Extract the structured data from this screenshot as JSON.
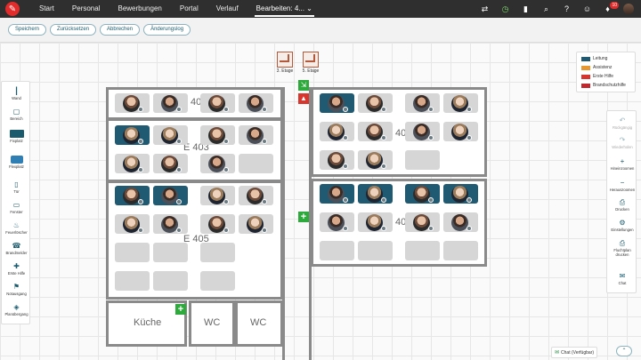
{
  "nav": {
    "items": [
      {
        "label": "Start"
      },
      {
        "label": "Personal"
      },
      {
        "label": "Bewerbungen"
      },
      {
        "label": "Portal"
      },
      {
        "label": "Verlauf"
      },
      {
        "label": "Bearbeiten: 4..."
      }
    ],
    "badge": "10"
  },
  "toolbar": {
    "save": "Speichern",
    "reset": "Zurücksetzen",
    "cancel": "Abbrechen",
    "changelog": "Änderungslog"
  },
  "palette": [
    {
      "label": "Wand",
      "icon": "wall-icon"
    },
    {
      "label": "Bereich",
      "icon": "area-icon"
    },
    {
      "label": "Fixplatz",
      "icon": "fixed-desk-icon"
    },
    {
      "label": "Flexplatz",
      "icon": "flex-desk-icon"
    },
    {
      "label": "Tür",
      "icon": "door-icon"
    },
    {
      "label": "Fenster",
      "icon": "window-icon"
    },
    {
      "label": "Feuerlöscher",
      "icon": "extinguisher-icon"
    },
    {
      "label": "Brandmelder",
      "icon": "fire-alarm-icon"
    },
    {
      "label": "Erste Hilfe",
      "icon": "first-aid-icon"
    },
    {
      "label": "Notausgang",
      "icon": "emergency-exit-icon"
    },
    {
      "label": "Planübergang",
      "icon": "plan-transition-icon"
    }
  ],
  "floors": [
    {
      "label": "3. Etage"
    },
    {
      "label": "5. Etage"
    }
  ],
  "legend": [
    {
      "label": "Leitung",
      "color": "#1f5a72"
    },
    {
      "label": "Assistenz",
      "color": "#e8962e"
    },
    {
      "label": "Erste Hilfe",
      "color": "#2eaa3c"
    },
    {
      "label": "Brandschutzhilfe",
      "color": "#d9352c"
    }
  ],
  "right_panel": [
    {
      "label": "Rückgängig",
      "icon": "undo-icon",
      "enabled": false
    },
    {
      "label": "Wiederholen",
      "icon": "redo-icon",
      "enabled": false
    },
    {
      "label": "Hineinzoomen",
      "icon": "zoom-in-icon",
      "enabled": true
    },
    {
      "label": "Herauszoomen",
      "icon": "zoom-out-icon",
      "enabled": true
    },
    {
      "label": "Drucken",
      "icon": "print-icon",
      "enabled": true
    },
    {
      "label": "Einstellungen",
      "icon": "settings-icon",
      "enabled": true
    },
    {
      "label": "Fluchtplan drucken",
      "icon": "escape-plan-icon",
      "enabled": true
    },
    {
      "label": "Chat",
      "icon": "chat-icon",
      "enabled": true
    }
  ],
  "rooms": {
    "r40a": "40",
    "e403": "E 403",
    "e405": "E 405",
    "r40b": "40",
    "r40c": "40",
    "kitchen": "Küche",
    "wc1": "WC",
    "wc2": "WC"
  },
  "chat": {
    "label": "Chat (Verfügbar)"
  }
}
